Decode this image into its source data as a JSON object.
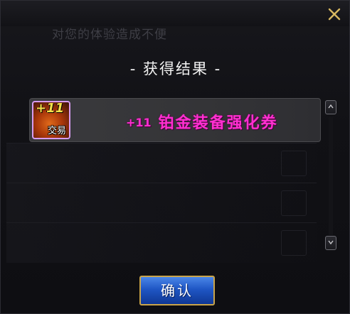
{
  "dialog": {
    "background_text": "对您的体验造成不便",
    "title": "- 获得结果 -",
    "close_icon": "close-x-icon"
  },
  "reward": {
    "icon_name": "enhancement-ticket-icon",
    "icon_badge": "+11",
    "icon_tag": "交易",
    "level": "+11",
    "name": "铂金装备强化券",
    "name_color": "#ff2fd0"
  },
  "scroll": {
    "up_icon": "chevron-up-icon",
    "down_icon": "chevron-down-icon"
  },
  "actions": {
    "confirm_label": "确认"
  }
}
